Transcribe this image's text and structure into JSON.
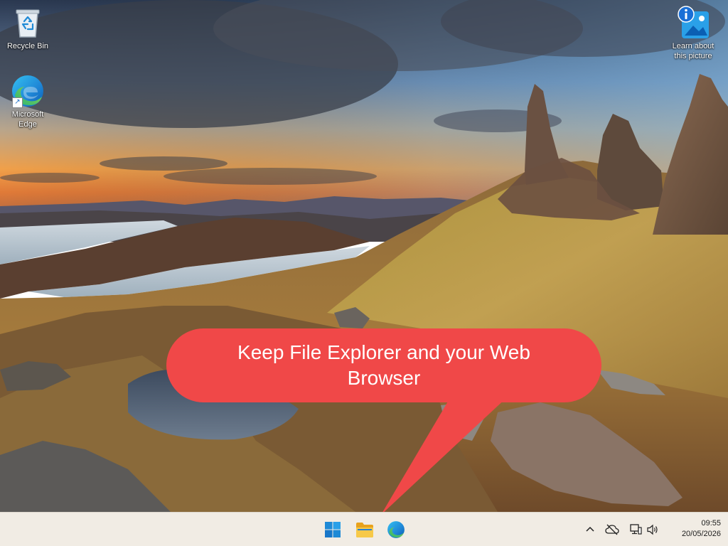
{
  "desktop": {
    "icons": [
      {
        "id": "recycle_bin",
        "label": "Recycle Bin"
      },
      {
        "id": "microsoft_edge",
        "label": "Microsoft\nEdge"
      },
      {
        "id": "learn_picture",
        "label": "Learn about\nthis picture"
      }
    ]
  },
  "callout": {
    "text": "Keep File Explorer and your Web Browser",
    "color": "#f04848"
  },
  "taskbar": {
    "pinned": [
      {
        "id": "start",
        "icon": "windows-logo-icon"
      },
      {
        "id": "file_explorer",
        "icon": "folder-icon"
      },
      {
        "id": "edge",
        "icon": "edge-icon"
      }
    ],
    "tray": [
      {
        "id": "overflow",
        "icon": "chevron-up-icon"
      },
      {
        "id": "onedrive",
        "icon": "cloud-offline-icon"
      },
      {
        "id": "network",
        "icon": "network-icon"
      },
      {
        "id": "volume",
        "icon": "volume-icon"
      }
    ],
    "clock": {
      "time": "09:55",
      "date": "20/05/2026"
    },
    "background": "#f1ece4"
  }
}
